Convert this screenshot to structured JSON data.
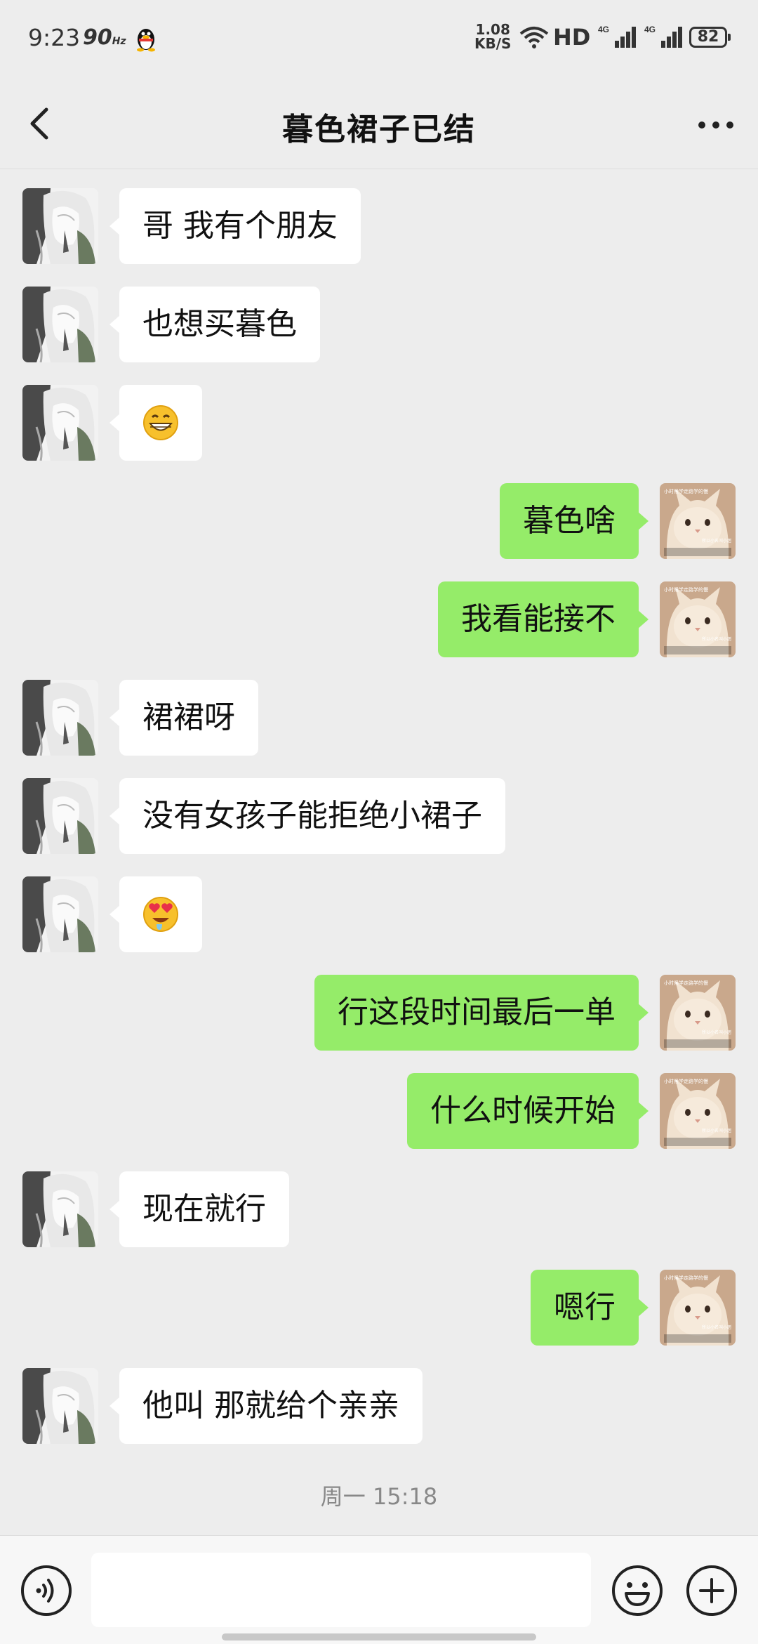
{
  "status_bar": {
    "time": "9:23",
    "refresh": "90",
    "refresh_unit": "Hz",
    "speed_value": "1.08",
    "speed_unit": "KB/S",
    "network": "HD",
    "signal1": "4G",
    "signal2": "4G",
    "battery": "82"
  },
  "header": {
    "title": "暮色裙子已结",
    "back_icon": "chevron-left-icon",
    "more_icon": "more-dots-icon"
  },
  "colors": {
    "background": "#ededed",
    "incoming_bubble": "#ffffff",
    "outgoing_bubble": "#95ec69"
  },
  "messages": [
    {
      "direction": "in",
      "text": "哥 我有个朋友"
    },
    {
      "direction": "in",
      "text": "也想买暮色"
    },
    {
      "direction": "in",
      "emoji": "grin-emoji",
      "text": "😁"
    },
    {
      "direction": "out",
      "text": "暮色啥"
    },
    {
      "direction": "out",
      "text": "我看能接不"
    },
    {
      "direction": "in",
      "text": "裙裙呀"
    },
    {
      "direction": "in",
      "text": "没有女孩子能拒绝小裙子"
    },
    {
      "direction": "in",
      "emoji": "heart-eyes-emoji",
      "text": "😍"
    },
    {
      "direction": "out",
      "text": "行这段时间最后一单"
    },
    {
      "direction": "out",
      "text": "什么时候开始"
    },
    {
      "direction": "in",
      "text": "现在就行"
    },
    {
      "direction": "out",
      "text": "嗯行"
    },
    {
      "direction": "in",
      "text": "他叫 那就给个亲亲"
    }
  ],
  "cat_avatar_caption": "你也可以叫我旗鼓",
  "timestamp": "周一 15:18",
  "input_bar": {
    "voice_icon": "voice-icon",
    "input_value": "",
    "emoji_icon": "smiley-icon",
    "plus_icon": "plus-icon"
  }
}
